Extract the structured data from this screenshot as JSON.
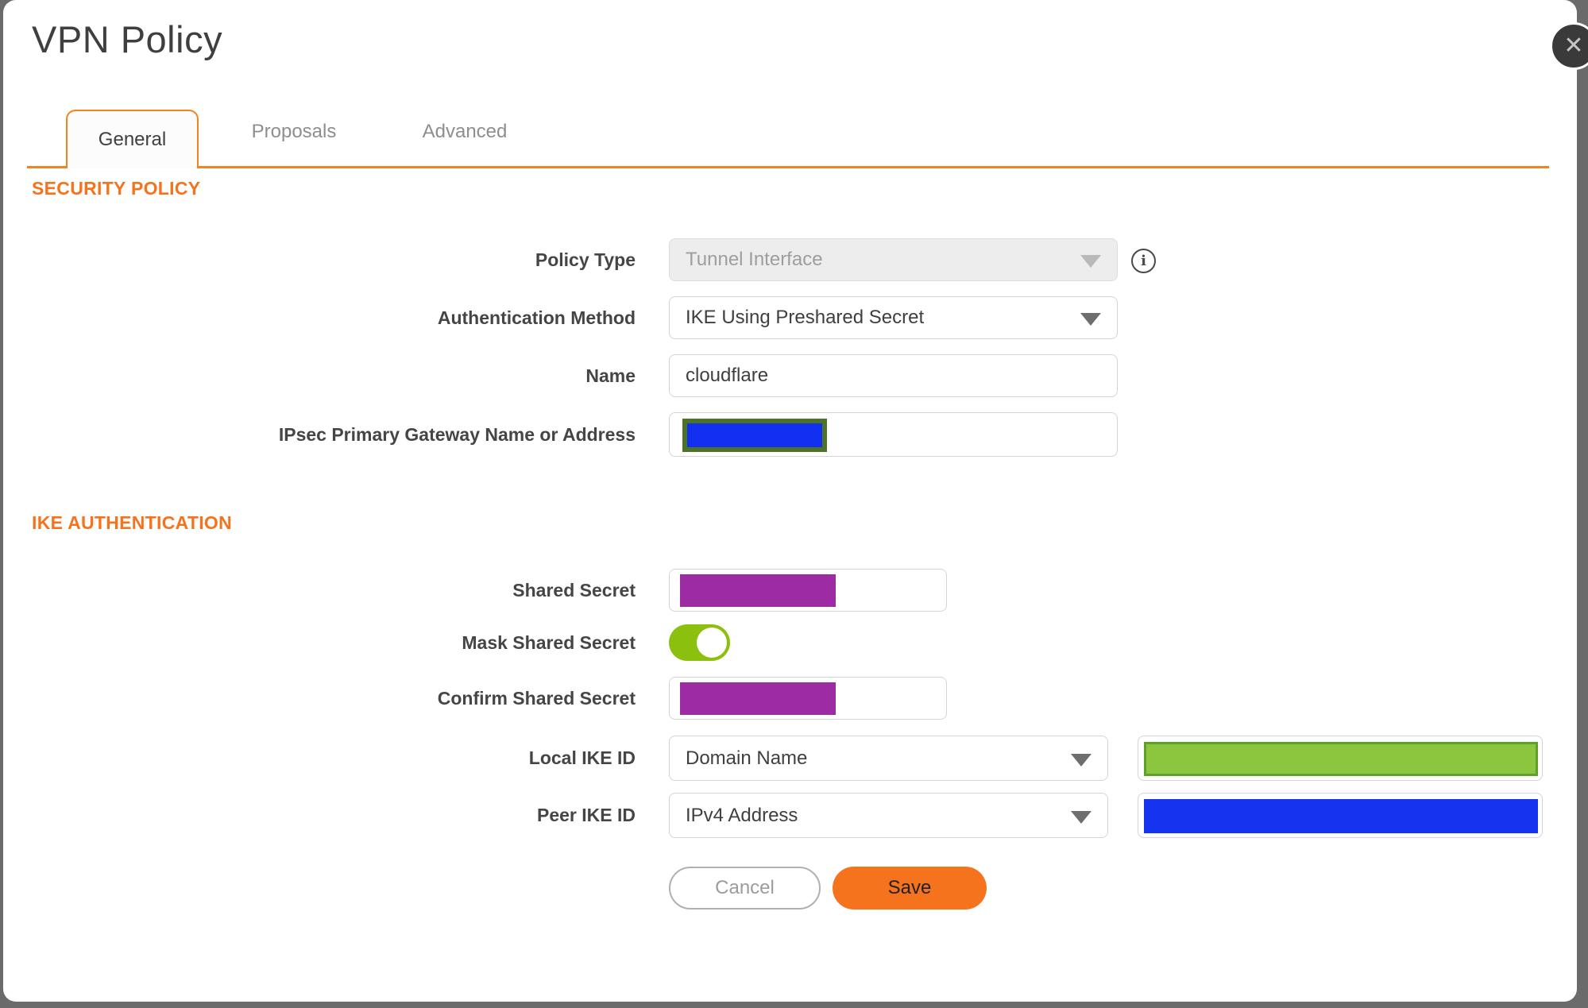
{
  "dialog": {
    "title": "VPN Policy"
  },
  "close": {
    "icon": "✕"
  },
  "tabs": [
    {
      "label": "General",
      "active": true
    },
    {
      "label": "Proposals",
      "active": false
    },
    {
      "label": "Advanced",
      "active": false
    }
  ],
  "sections": {
    "security_policy": "SECURITY POLICY",
    "ike_authentication": "IKE AUTHENTICATION"
  },
  "form": {
    "policy_type": {
      "label": "Policy Type",
      "value": "Tunnel Interface",
      "disabled": true
    },
    "authentication_method": {
      "label": "Authentication Method",
      "value": "IKE Using Preshared Secret"
    },
    "name": {
      "label": "Name",
      "value": "cloudflare"
    },
    "ipsec_gateway": {
      "label": "IPsec Primary Gateway Name or Address",
      "value": "",
      "redacted": true
    },
    "shared_secret": {
      "label": "Shared Secret",
      "value": "",
      "redacted": true
    },
    "mask_shared_secret": {
      "label": "Mask Shared Secret",
      "state": "on"
    },
    "confirm_shared_secret": {
      "label": "Confirm Shared Secret",
      "value": "",
      "redacted": true
    },
    "local_ike_id": {
      "label": "Local IKE ID",
      "value": "Domain Name",
      "id_value_redacted": true
    },
    "peer_ike_id": {
      "label": "Peer IKE ID",
      "value": "IPv4 Address",
      "id_value_redacted": true
    }
  },
  "info_icon_glyph": "i",
  "buttons": {
    "cancel": "Cancel",
    "save": "Save"
  },
  "colors": {
    "accent_orange": "#F58220",
    "heading_orange": "#F5731D",
    "save_orange": "#F6731E",
    "toggle_green": "#8CC00E",
    "redact_purple": "#9C2BA4",
    "redact_blue": "#1634F0",
    "redact_green_fill": "#8CC63F",
    "redact_green_border": "#5FA02C",
    "redact_olive_border": "#4D7326",
    "backdrop": "#6B6B6B"
  }
}
